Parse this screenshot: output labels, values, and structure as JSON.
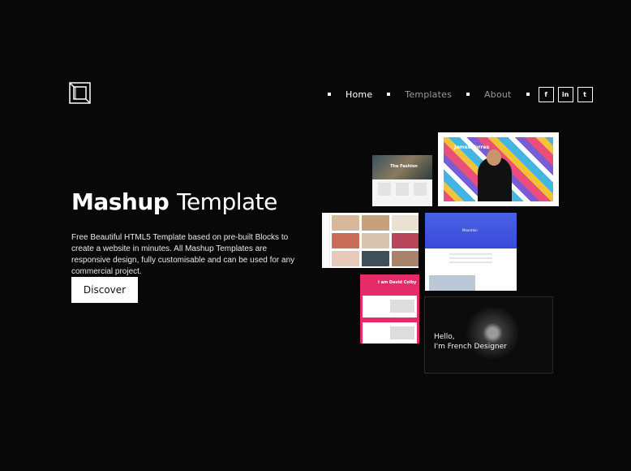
{
  "nav": {
    "items": [
      {
        "label": "Home",
        "active": true
      },
      {
        "label": "Templates",
        "active": false
      },
      {
        "label": "About",
        "active": false
      }
    ],
    "social": [
      "f",
      "in",
      "t"
    ]
  },
  "hero": {
    "title_bold": "Mashup",
    "title_regular": "Template",
    "description": "Free Beautiful HTML5 Template based on pre-built Blocks to create a website in minutes. All Mashup Templates are responsive design, fully customisable and can be used for any commercial project.",
    "button_label": "Discover"
  },
  "previews": {
    "portfolio_name": "James Torres",
    "fashion_title": "The Fashion",
    "blue_title": "Mountain",
    "pink_title": "I am David Colby",
    "dark_hello_1": "Hello,",
    "dark_hello_2": "I'm French Designer"
  },
  "colors": {
    "background": "#080808",
    "accent_pink": "#e52b68",
    "accent_blue": "#4862e6"
  }
}
